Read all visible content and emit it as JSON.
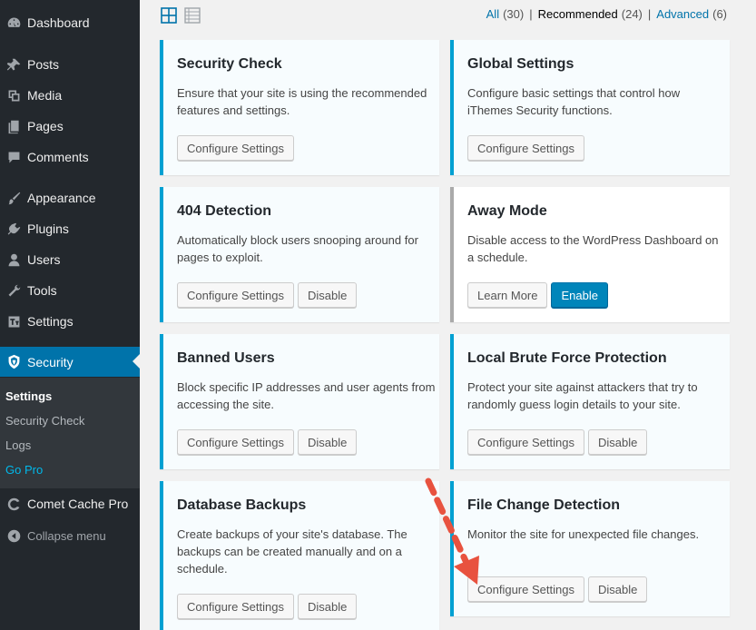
{
  "sidebar": {
    "items": [
      {
        "label": "Dashboard",
        "icon": "dashboard-icon"
      },
      {
        "label": "Posts",
        "icon": "pin-icon"
      },
      {
        "label": "Media",
        "icon": "media-icon"
      },
      {
        "label": "Pages",
        "icon": "pages-icon"
      },
      {
        "label": "Comments",
        "icon": "comment-icon"
      },
      {
        "label": "Appearance",
        "icon": "brush-icon"
      },
      {
        "label": "Plugins",
        "icon": "plugin-icon"
      },
      {
        "label": "Users",
        "icon": "user-icon"
      },
      {
        "label": "Tools",
        "icon": "wrench-icon"
      },
      {
        "label": "Settings",
        "icon": "settings-icon"
      },
      {
        "label": "Security",
        "icon": "shield-icon"
      }
    ],
    "submenu": [
      "Settings",
      "Security Check",
      "Logs",
      "Go Pro"
    ],
    "comet_cache": "Comet Cache Pro",
    "collapse": "Collapse menu"
  },
  "filters": {
    "all": "All",
    "all_count": "(30)",
    "recommended": "Recommended",
    "recommended_count": "(24)",
    "advanced": "Advanced",
    "advanced_count": "(6)",
    "separator": "|"
  },
  "cards": [
    {
      "title": "Security Check",
      "desc": "Ensure that your site is using the recommended features and settings.",
      "btn1": "Configure Settings"
    },
    {
      "title": "Global Settings",
      "desc": "Configure basic settings that control how iThemes Security functions.",
      "btn1": "Configure Settings"
    },
    {
      "title": "404 Detection",
      "desc": "Automatically block users snooping around for pages to exploit.",
      "btn1": "Configure Settings",
      "btn2": "Disable"
    },
    {
      "title": "Away Mode",
      "desc": "Disable access to the WordPress Dashboard on a schedule.",
      "btn1": "Learn More",
      "btn2": "Enable"
    },
    {
      "title": "Banned Users",
      "desc": "Block specific IP addresses and user agents from accessing the site.",
      "btn1": "Configure Settings",
      "btn2": "Disable"
    },
    {
      "title": "Local Brute Force Protection",
      "desc": "Protect your site against attackers that try to randomly guess login details to your site.",
      "btn1": "Configure Settings",
      "btn2": "Disable"
    },
    {
      "title": "Database Backups",
      "desc": "Create backups of your site's database. The backups can be created manually and on a schedule.",
      "btn1": "Configure Settings",
      "btn2": "Disable"
    },
    {
      "title": "File Change Detection",
      "desc": "Monitor the site for unexpected file changes.",
      "btn1": "Configure Settings",
      "btn2": "Disable"
    }
  ],
  "colors": {
    "accent": "#00a0d2",
    "primary": "#0085ba",
    "sidebar": "#23282d",
    "annotation_arrow": "#e8523f"
  }
}
